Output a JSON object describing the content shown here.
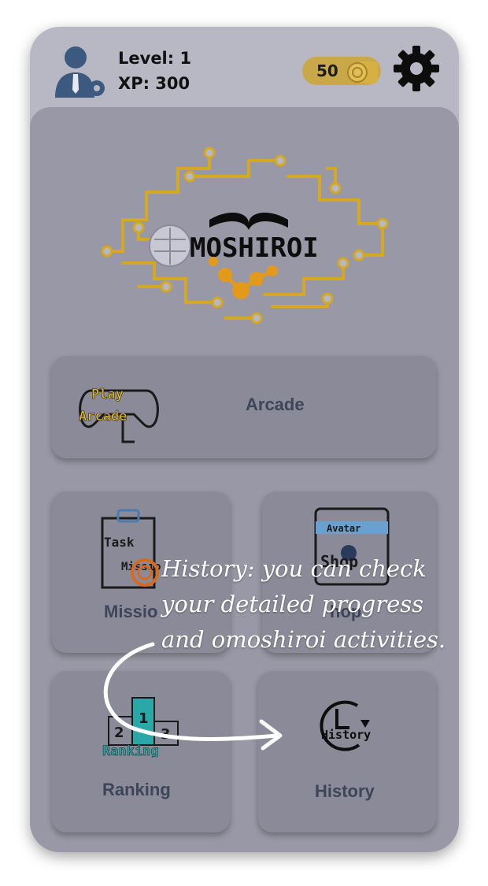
{
  "header": {
    "level_label": "Level: 1",
    "xp_label": "XP: 300",
    "coins": "50"
  },
  "logo": {
    "brand": "MOSHIROI"
  },
  "tiles": {
    "arcade": {
      "label": "Arcade",
      "icon_top": "Play",
      "icon_bottom": "Arcade"
    },
    "missions": {
      "label": "Missio",
      "icon_top": "Task",
      "icon_bottom": "Missio"
    },
    "shop": {
      "label": "hop",
      "icon_top": "Avatar",
      "icon_bottom": "Shop"
    },
    "ranking": {
      "label": "Ranking",
      "icon_text": "Ranking",
      "place_left": "2",
      "place_center": "1",
      "place_right": "3"
    },
    "history": {
      "label": "History",
      "icon_text": "History"
    }
  },
  "tooltip": {
    "line1": "History: you can check",
    "line2": "your detailed progress",
    "line3": "and omoshiroi activities."
  },
  "colors": {
    "overlay_bg": "#9898a6",
    "tile_bg": "#8a8a98",
    "label": "#3c4658",
    "coin": "#c9a84a",
    "gold": "#d4a820"
  }
}
